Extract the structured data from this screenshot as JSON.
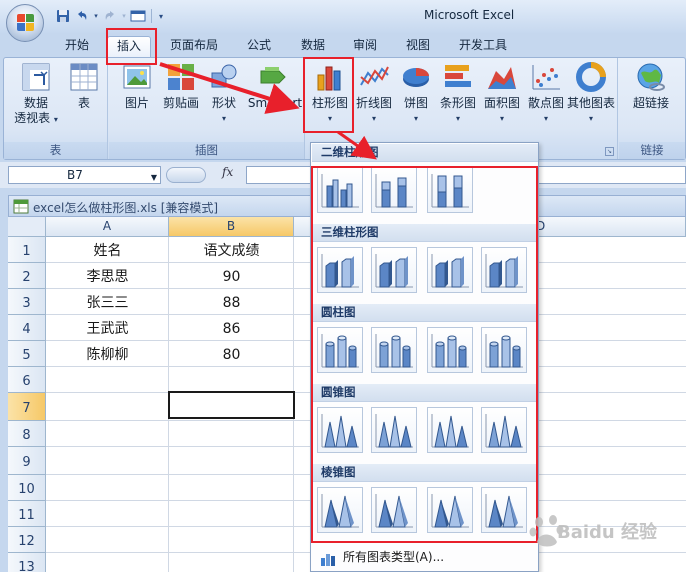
{
  "title_bar": {
    "app_title": "Microsoft Excel"
  },
  "tabs": [
    {
      "id": "home",
      "label": "开始"
    },
    {
      "id": "insert",
      "label": "插入",
      "active": true
    },
    {
      "id": "page_layout",
      "label": "页面布局"
    },
    {
      "id": "formulas",
      "label": "公式"
    },
    {
      "id": "data",
      "label": "数据"
    },
    {
      "id": "review",
      "label": "审阅"
    },
    {
      "id": "view",
      "label": "视图"
    },
    {
      "id": "developer",
      "label": "开发工具"
    }
  ],
  "ribbon": {
    "groups": {
      "tables": "表",
      "illustrations": "插图",
      "links": "链接"
    },
    "buttons": {
      "pivot_line1": "数据",
      "pivot_line2": "透视表",
      "table": "表",
      "picture": "图片",
      "clipart": "剪贴画",
      "shapes": "形状",
      "smartart": "SmartArt",
      "column_chart": "柱形图",
      "line_chart": "折线图",
      "pie_chart": "饼图",
      "bar_chart": "条形图",
      "area_chart": "面积图",
      "scatter_chart": "散点图",
      "other_charts": "其他图表",
      "hyperlink": "超链接"
    }
  },
  "formula_bar": {
    "name_box": "B7",
    "fx_label": "fx"
  },
  "workbook": {
    "title": "excel怎么做柱形图.xls  [兼容模式]"
  },
  "sheet": {
    "columns": [
      "A",
      "B",
      "D"
    ],
    "rows": [
      "1",
      "2",
      "3",
      "4",
      "5",
      "6",
      "7",
      "8",
      "9",
      "10",
      "11",
      "12",
      "13"
    ],
    "selected_cell": "B7",
    "cells": [
      [
        "姓名",
        "语文成绩"
      ],
      [
        "李思思",
        "90"
      ],
      [
        "张三三",
        "88"
      ],
      [
        "王武武",
        "86"
      ],
      [
        "陈柳柳",
        "80"
      ]
    ]
  },
  "gallery": {
    "sections": [
      {
        "title": "二维柱形图",
        "count": 3
      },
      {
        "title": "三维柱形图",
        "count": 4
      },
      {
        "title": "圆柱图",
        "count": 4
      },
      {
        "title": "圆锥图",
        "count": 4
      },
      {
        "title": "棱锥图",
        "count": 4
      }
    ],
    "all_chart_types": "所有图表类型(A)..."
  },
  "watermark": {
    "text": "Baidu 经验"
  },
  "colors": {
    "highlight": "#e8202b",
    "ribbon_bg": "#dbe6f5",
    "selected_header": "#f6c867"
  }
}
